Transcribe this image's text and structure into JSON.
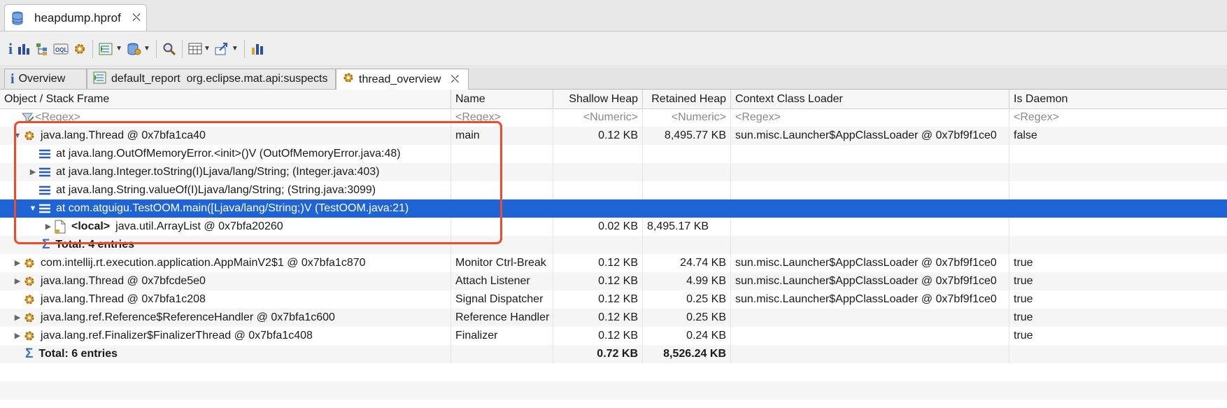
{
  "window": {
    "tab_title": "heapdump.hprof"
  },
  "toolbar": {
    "icons": [
      "info-icon",
      "histogram-icon",
      "dominator-tree-icon",
      "oql-icon",
      "thread-overview-icon",
      "report-icon",
      "query-browser-icon",
      "search-icon",
      "table-layout-icon",
      "export-icon",
      "compare-icon"
    ]
  },
  "inner_tabs": [
    {
      "label": "Overview"
    },
    {
      "label": "default_report  org.eclipse.mat.api:suspects"
    },
    {
      "label": "thread_overview"
    }
  ],
  "columns": {
    "object": "Object / Stack Frame",
    "name": "Name",
    "shallow": "Shallow Heap",
    "retained": "Retained Heap",
    "loader": "Context Class Loader",
    "daemon": "Is Daemon"
  },
  "filter": {
    "object": "<Regex>",
    "name": "<Regex>",
    "shallow": "<Numeric>",
    "retained": "<Numeric>",
    "loader": "<Regex>",
    "daemon": "<Regex>"
  },
  "rows": [
    {
      "object": "java.lang.Thread @ 0x7bfa1ca40",
      "name": "main",
      "shallow": "0.12 KB",
      "retained": "8,495.77 KB",
      "loader": "sun.misc.Launcher$AppClassLoader @ 0x7bf9f1ce0",
      "daemon": "false"
    },
    {
      "object": "at java.lang.OutOfMemoryError.<init>()V (OutOfMemoryError.java:48)"
    },
    {
      "object": "at java.lang.Integer.toString(I)Ljava/lang/String; (Integer.java:403)"
    },
    {
      "object": "at java.lang.String.valueOf(I)Ljava/lang/String; (String.java:3099)"
    },
    {
      "object": "at com.atguigu.TestOOM.main([Ljava/lang/String;)V (TestOOM.java:21)"
    },
    {
      "object_tag": "<local>",
      "object": "java.util.ArrayList @ 0x7bfa20260",
      "shallow": "0.02 KB",
      "retained": "8,495.17 KB"
    },
    {
      "object": "Total: 4 entries"
    },
    {
      "object": "com.intellij.rt.execution.application.AppMainV2$1 @ 0x7bfa1c870",
      "name": "Monitor Ctrl-Break",
      "shallow": "0.12 KB",
      "retained": "24.74 KB",
      "loader": "sun.misc.Launcher$AppClassLoader @ 0x7bf9f1ce0",
      "daemon": "true"
    },
    {
      "object": "java.lang.Thread @ 0x7bfcde5e0",
      "name": "Attach Listener",
      "shallow": "0.12 KB",
      "retained": "4.99 KB",
      "loader": "sun.misc.Launcher$AppClassLoader @ 0x7bf9f1ce0",
      "daemon": "true"
    },
    {
      "object": "java.lang.Thread @ 0x7bfa1c208",
      "name": "Signal Dispatcher",
      "shallow": "0.12 KB",
      "retained": "0.25 KB",
      "loader": "sun.misc.Launcher$AppClassLoader @ 0x7bf9f1ce0",
      "daemon": "true"
    },
    {
      "object": "java.lang.ref.Reference$ReferenceHandler @ 0x7bfa1c600",
      "name": "Reference Handler",
      "shallow": "0.12 KB",
      "retained": "0.25 KB",
      "daemon": "true"
    },
    {
      "object": "java.lang.ref.Finalizer$FinalizerThread @ 0x7bfa1c408",
      "name": "Finalizer",
      "shallow": "0.12 KB",
      "retained": "0.24 KB",
      "daemon": "true"
    },
    {
      "object": "Total: 6 entries",
      "shallow": "0.72 KB",
      "retained": "8,526.24 KB"
    }
  ],
  "colors": {
    "selection": "#1f64d6",
    "highlight_box": "#ee4b2b",
    "sigma": "#3a6fc4"
  }
}
